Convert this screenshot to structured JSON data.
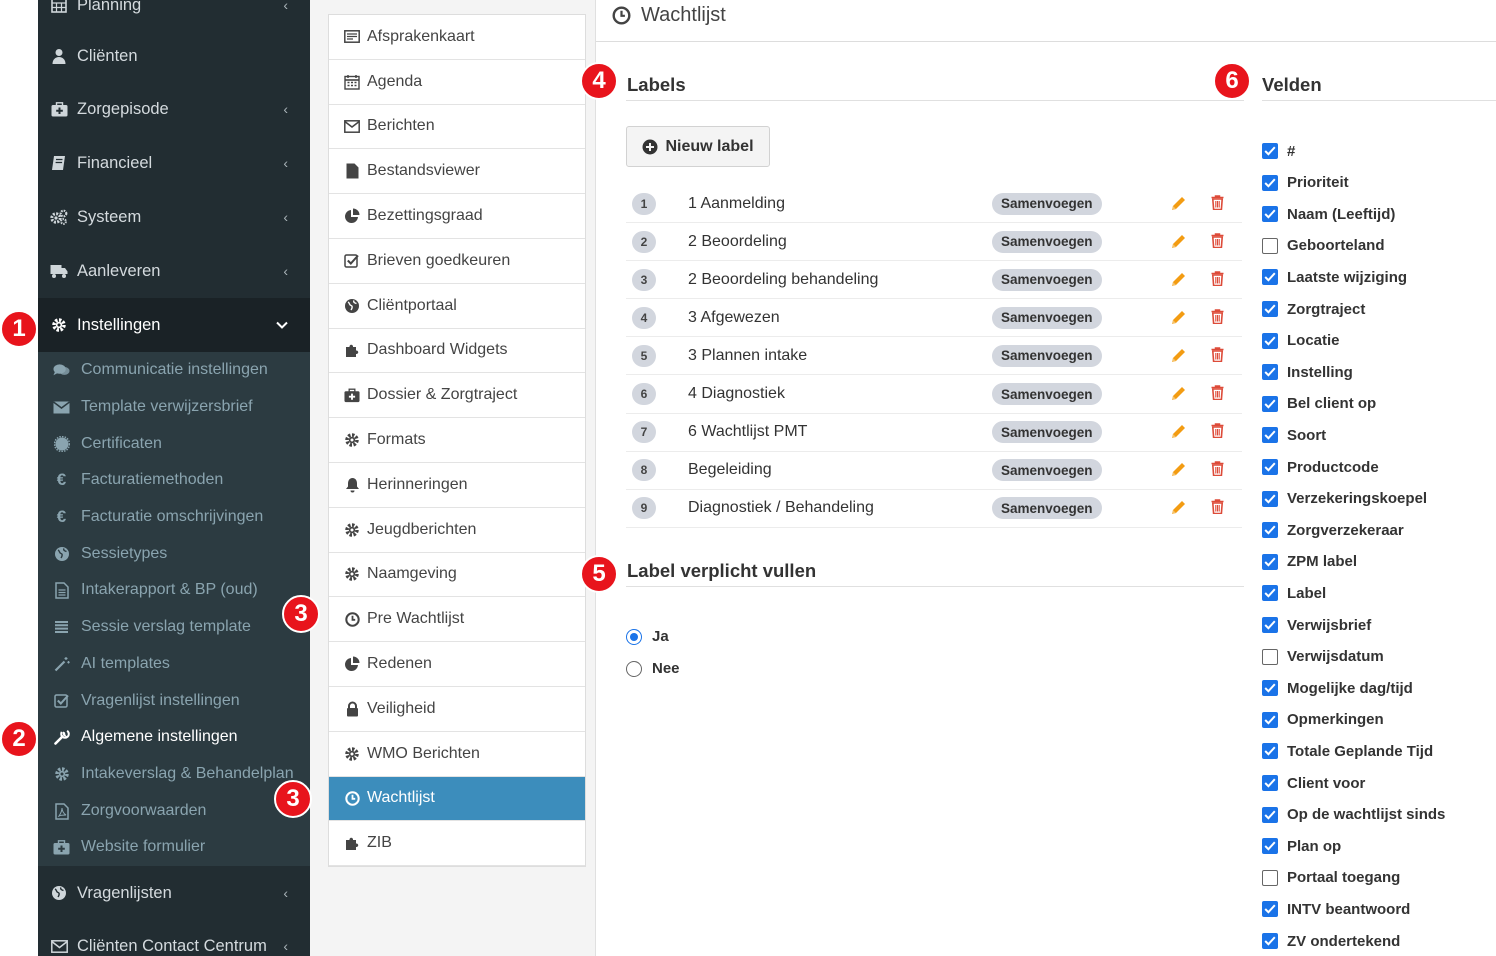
{
  "sidebar": {
    "items": [
      {
        "label": "Planning",
        "icon": "calendar-grid-icon",
        "chevron": "‹"
      },
      {
        "label": "Cliënten",
        "icon": "user-icon",
        "chevron": ""
      },
      {
        "label": "Zorgepisode",
        "icon": "medkit-icon",
        "chevron": "‹"
      },
      {
        "label": "Financieel",
        "icon": "book-icon",
        "chevron": "‹"
      },
      {
        "label": "Systeem",
        "icon": "cogs-icon",
        "chevron": "‹"
      },
      {
        "label": "Aanleveren",
        "icon": "truck-icon",
        "chevron": "‹"
      },
      {
        "label": "Instellingen",
        "icon": "gear-icon",
        "chevron": "⌄"
      },
      {
        "label": "Vragenlijsten",
        "icon": "globe-icon",
        "chevron": "‹"
      },
      {
        "label": "Cliënten Contact Centrum",
        "icon": "envelope-icon",
        "chevron": "‹"
      }
    ],
    "sub_items": [
      {
        "label": "Communicatie instellingen",
        "icon": "comments-icon"
      },
      {
        "label": "Template verwijzersbrief",
        "icon": "envelope-icon"
      },
      {
        "label": "Certificaten",
        "icon": "certificate-icon"
      },
      {
        "label": "Facturatiemethoden",
        "icon": "euro-icon"
      },
      {
        "label": "Facturatie omschrijvingen",
        "icon": "euro-icon"
      },
      {
        "label": "Sessietypes",
        "icon": "globe-icon"
      },
      {
        "label": "Intakerapport & BP (oud)",
        "icon": "file-text-icon"
      },
      {
        "label": "Sessie verslag template",
        "icon": "list-icon"
      },
      {
        "label": "AI templates",
        "icon": "magic-wand-icon"
      },
      {
        "label": "Vragenlijst instellingen",
        "icon": "check-square-icon"
      },
      {
        "label": "Algemene instellingen",
        "icon": "wrench-icon"
      },
      {
        "label": "Intakeverslag & Behandelplan",
        "icon": "gear-icon"
      },
      {
        "label": "Zorgvoorwaarden",
        "icon": "pdf-file-icon"
      },
      {
        "label": "Website formulier",
        "icon": "medkit-icon"
      }
    ]
  },
  "menu": {
    "items": [
      {
        "label": "Afsprakenkaart",
        "icon": "id-card-icon"
      },
      {
        "label": "Agenda",
        "icon": "calendar-icon"
      },
      {
        "label": "Berichten",
        "icon": "envelope-icon"
      },
      {
        "label": "Bestandsviewer",
        "icon": "file-icon"
      },
      {
        "label": "Bezettingsgraad",
        "icon": "pie-chart-icon"
      },
      {
        "label": "Brieven goedkeuren",
        "icon": "check-square-icon"
      },
      {
        "label": "Cliëntportaal",
        "icon": "globe-icon"
      },
      {
        "label": "Dashboard Widgets",
        "icon": "puzzle-icon"
      },
      {
        "label": "Dossier & Zorgtraject",
        "icon": "medkit-icon"
      },
      {
        "label": "Formats",
        "icon": "gear-icon"
      },
      {
        "label": "Herinneringen",
        "icon": "bell-icon"
      },
      {
        "label": "Jeugdberichten",
        "icon": "gear-icon"
      },
      {
        "label": "Naamgeving",
        "icon": "gear-icon"
      },
      {
        "label": "Pre Wachtlijst",
        "icon": "clock-icon"
      },
      {
        "label": "Redenen",
        "icon": "pie-chart-icon"
      },
      {
        "label": "Veiligheid",
        "icon": "lock-icon"
      },
      {
        "label": "WMO Berichten",
        "icon": "gear-icon"
      },
      {
        "label": "Wachtlijst",
        "icon": "clock-icon"
      },
      {
        "label": "ZIB",
        "icon": "puzzle-icon"
      }
    ]
  },
  "main": {
    "title": "Wachtlijst",
    "labels_heading": "Labels",
    "new_label_button": "Nieuw label",
    "merge_badge": "Samenvoegen",
    "labels": [
      {
        "num": "1",
        "name": "1 Aanmelding"
      },
      {
        "num": "2",
        "name": "2 Beoordeling"
      },
      {
        "num": "3",
        "name": "2 Beoordeling behandeling"
      },
      {
        "num": "4",
        "name": "3 Afgewezen"
      },
      {
        "num": "5",
        "name": "3 Plannen intake"
      },
      {
        "num": "6",
        "name": "4 Diagnostiek"
      },
      {
        "num": "7",
        "name": "6 Wachtlijst PMT"
      },
      {
        "num": "8",
        "name": "Begeleiding"
      },
      {
        "num": "9",
        "name": "Diagnostiek / Behandeling"
      }
    ],
    "required_heading": "Label verplicht vullen",
    "radio": {
      "yes": "Ja",
      "no": "Nee",
      "selected": "Ja"
    },
    "fields_heading": "Velden",
    "fields": [
      {
        "label": "#",
        "checked": true
      },
      {
        "label": "Prioriteit",
        "checked": true
      },
      {
        "label": "Naam (Leeftijd)",
        "checked": true
      },
      {
        "label": "Geboorteland",
        "checked": false
      },
      {
        "label": "Laatste wijziging",
        "checked": true
      },
      {
        "label": "Zorgtraject",
        "checked": true
      },
      {
        "label": "Locatie",
        "checked": true
      },
      {
        "label": "Instelling",
        "checked": true
      },
      {
        "label": "Bel client op",
        "checked": true
      },
      {
        "label": "Soort",
        "checked": true
      },
      {
        "label": "Productcode",
        "checked": true
      },
      {
        "label": "Verzekeringskoepel",
        "checked": true
      },
      {
        "label": "Zorgverzekeraar",
        "checked": true
      },
      {
        "label": "ZPM label",
        "checked": true
      },
      {
        "label": "Label",
        "checked": true
      },
      {
        "label": "Verwijsbrief",
        "checked": true
      },
      {
        "label": "Verwijsdatum",
        "checked": false
      },
      {
        "label": "Mogelijke dag/tijd",
        "checked": true
      },
      {
        "label": "Opmerkingen",
        "checked": true
      },
      {
        "label": "Totale Geplande Tijd",
        "checked": true
      },
      {
        "label": "Client voor",
        "checked": true
      },
      {
        "label": "Op de wachtlijst sinds",
        "checked": true
      },
      {
        "label": "Plan op",
        "checked": true
      },
      {
        "label": "Portaal toegang",
        "checked": false
      },
      {
        "label": "INTV beantwoord",
        "checked": true
      },
      {
        "label": "ZV ondertekend",
        "checked": true
      }
    ]
  },
  "markers": [
    "1",
    "2",
    "3",
    "3",
    "4",
    "5",
    "6"
  ],
  "colors": {
    "sidebar": "#222d32",
    "submenu": "#2c3b41",
    "accent": "#3c8dbc",
    "edit": "#f39c12",
    "delete": "#dd4b39",
    "marker": "#e8141c",
    "checkbox": "#1a73e8"
  }
}
